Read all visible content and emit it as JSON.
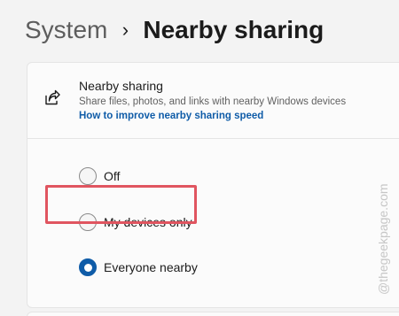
{
  "breadcrumb": {
    "parent": "System",
    "separator": "›",
    "current": "Nearby sharing"
  },
  "card": {
    "icon": "share-icon",
    "title": "Nearby sharing",
    "description": "Share files, photos, and links with nearby Windows devices",
    "link": "How to improve nearby sharing speed"
  },
  "options": [
    {
      "label": "Off",
      "selected": false
    },
    {
      "label": "My devices only",
      "selected": false
    },
    {
      "label": "Everyone nearby",
      "selected": true
    }
  ],
  "highlight_color": "#e05560",
  "accent_color": "#0f5ca8",
  "watermark": "@thegeekpage.com"
}
